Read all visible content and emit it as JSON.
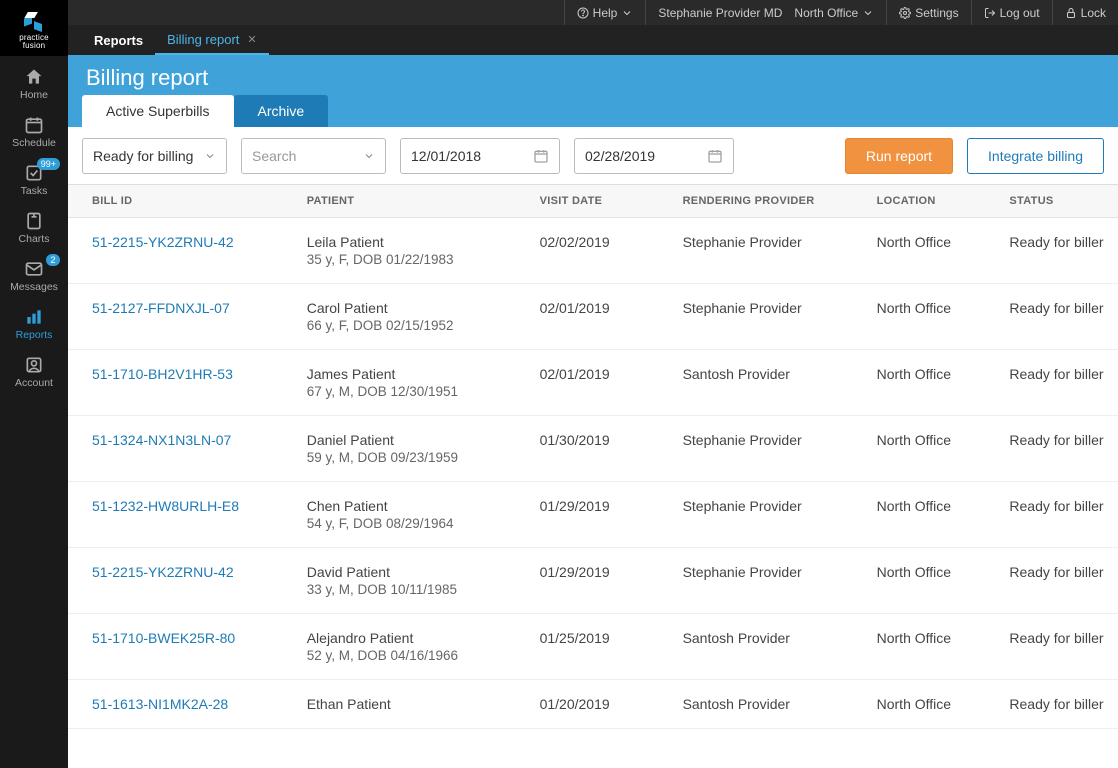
{
  "topbar": {
    "help": "Help",
    "user": "Stephanie Provider MD",
    "office": "North Office",
    "settings": "Settings",
    "logout": "Log out",
    "lock": "Lock"
  },
  "brand": {
    "line1": "practice",
    "line2": "fusion"
  },
  "sidebar": [
    {
      "key": "home",
      "label": "Home",
      "badge": ""
    },
    {
      "key": "schedule",
      "label": "Schedule",
      "badge": ""
    },
    {
      "key": "tasks",
      "label": "Tasks",
      "badge": "99+"
    },
    {
      "key": "charts",
      "label": "Charts",
      "badge": ""
    },
    {
      "key": "messages",
      "label": "Messages",
      "badge": "2"
    },
    {
      "key": "reports",
      "label": "Reports",
      "badge": ""
    },
    {
      "key": "account",
      "label": "Account",
      "badge": ""
    }
  ],
  "breadcrumb": {
    "root": "Reports",
    "active": "Billing report"
  },
  "header": {
    "title": "Billing report",
    "tab_active": "Active Superbills",
    "tab_archive": "Archive"
  },
  "filters": {
    "status": "Ready for billing",
    "search_placeholder": "Search",
    "date_from": "12/01/2018",
    "date_to": "02/28/2019",
    "run": "Run report",
    "integrate": "Integrate billing"
  },
  "columns": {
    "bill_id": "BILL ID",
    "patient": "PATIENT",
    "visit_date": "VISIT DATE",
    "provider": "RENDERING PROVIDER",
    "location": "LOCATION",
    "status": "STATUS"
  },
  "rows": [
    {
      "bill_id": "51-2215-YK2ZRNU-42",
      "patient": "Leila Patient",
      "detail": "35 y, F, DOB 01/22/1983",
      "visit": "02/02/2019",
      "provider": "Stephanie Provider",
      "location": "North Office",
      "status": "Ready for biller"
    },
    {
      "bill_id": "51-2127-FFDNXJL-07",
      "patient": "Carol Patient",
      "detail": "66 y, F, DOB 02/15/1952",
      "visit": "02/01/2019",
      "provider": "Stephanie Provider",
      "location": "North Office",
      "status": "Ready for biller"
    },
    {
      "bill_id": "51-1710-BH2V1HR-53",
      "patient": "James Patient",
      "detail": "67 y, M, DOB 12/30/1951",
      "visit": "02/01/2019",
      "provider": "Santosh Provider",
      "location": "North Office",
      "status": "Ready for biller"
    },
    {
      "bill_id": "51-1324-NX1N3LN-07",
      "patient": "Daniel Patient",
      "detail": "59 y, M, DOB 09/23/1959",
      "visit": "01/30/2019",
      "provider": "Stephanie Provider",
      "location": "North Office",
      "status": "Ready for biller"
    },
    {
      "bill_id": "51-1232-HW8URLH-E8",
      "patient": "Chen Patient",
      "detail": "54 y, F, DOB 08/29/1964",
      "visit": "01/29/2019",
      "provider": "Stephanie Provider",
      "location": "North Office",
      "status": "Ready for biller"
    },
    {
      "bill_id": "51-2215-YK2ZRNU-42",
      "patient": "David Patient",
      "detail": "33 y, M, DOB 10/11/1985",
      "visit": "01/29/2019",
      "provider": "Stephanie Provider",
      "location": "North Office",
      "status": "Ready for biller"
    },
    {
      "bill_id": "51-1710-BWEK25R-80",
      "patient": "Alejandro Patient",
      "detail": "52 y, M, DOB 04/16/1966",
      "visit": "01/25/2019",
      "provider": "Santosh Provider",
      "location": "North Office",
      "status": "Ready for biller"
    },
    {
      "bill_id": "51-1613-NI1MK2A-28",
      "patient": "Ethan Patient",
      "detail": "",
      "visit": "01/20/2019",
      "provider": "Santosh Provider",
      "location": "North Office",
      "status": "Ready for biller"
    }
  ]
}
